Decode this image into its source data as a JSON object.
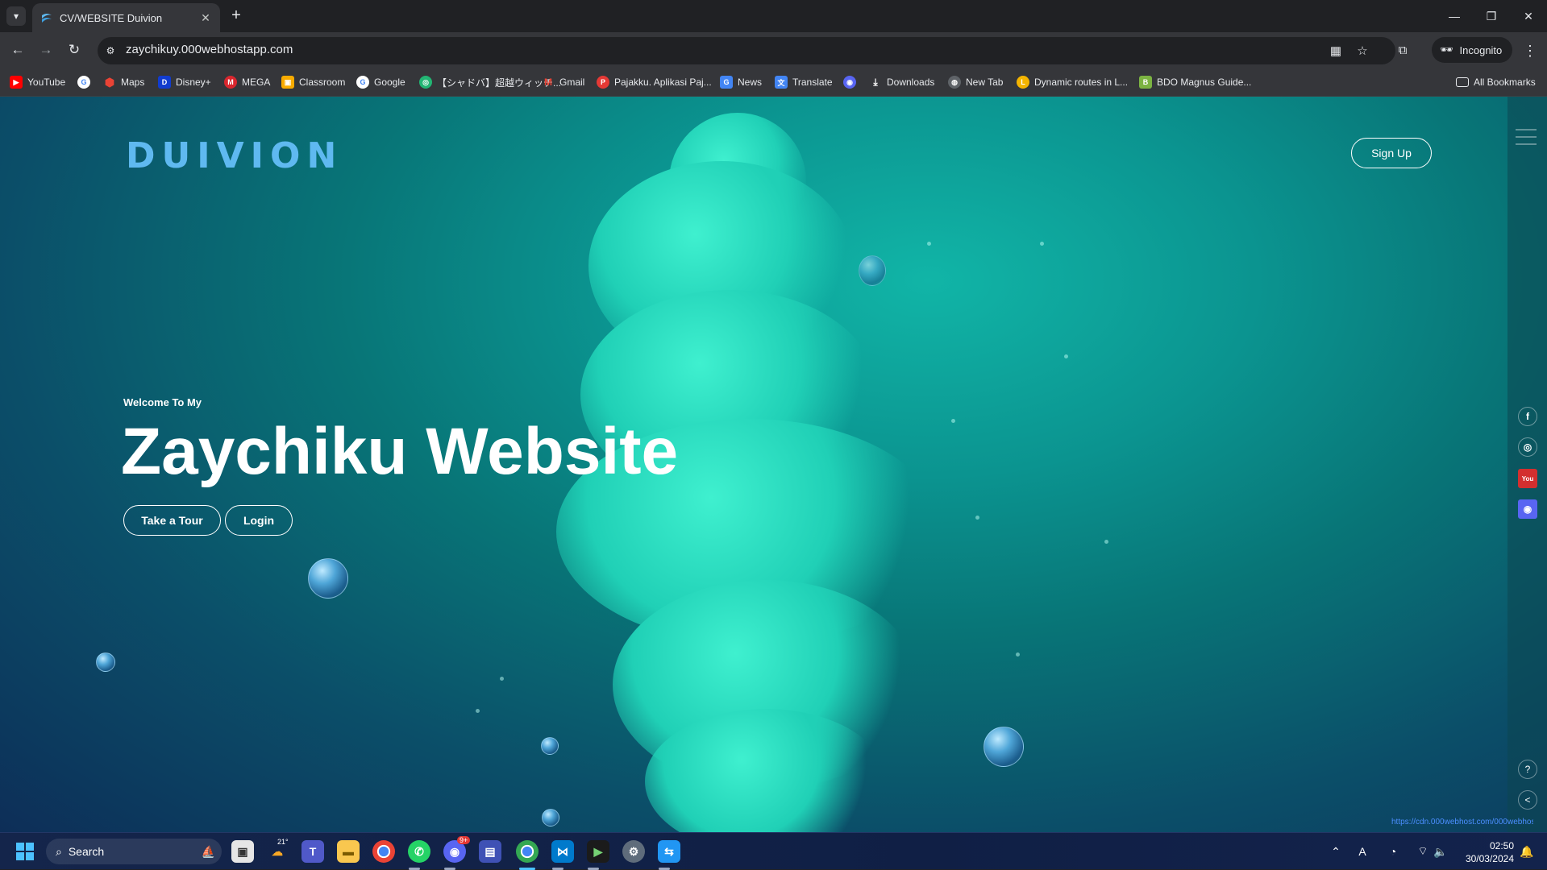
{
  "browser": {
    "tab_title": "CV/WEBSITE Duivion",
    "url": "zaychikuy.000webhostapp.com",
    "incognito_label": "Incognito",
    "all_bookmarks_label": "All Bookmarks",
    "bookmarks": [
      {
        "label": "YouTube",
        "icon": "youtube-icon",
        "color": "#ff0000"
      },
      {
        "label": "",
        "icon": "google-icon",
        "color": "#ffffff"
      },
      {
        "label": "Maps",
        "icon": "maps-icon",
        "color": "#34a853"
      },
      {
        "label": "Disney+",
        "icon": "disney-icon",
        "color": "#113ccf"
      },
      {
        "label": "MEGA",
        "icon": "mega-icon",
        "color": "#d9272e"
      },
      {
        "label": "Classroom",
        "icon": "classroom-icon",
        "color": "#f9ab00"
      },
      {
        "label": "Google",
        "icon": "google-icon",
        "color": "#ffffff"
      },
      {
        "label": "【シャドバ】超越ウィッチ...",
        "icon": "game-icon",
        "color": "#22b573"
      },
      {
        "label": "Gmail",
        "icon": "gmail-icon",
        "color": "#ea4335"
      },
      {
        "label": "Pajakku. Aplikasi Paj...",
        "icon": "pajakku-icon",
        "color": "#e53935"
      },
      {
        "label": "News",
        "icon": "news-icon",
        "color": "#4285f4"
      },
      {
        "label": "Translate",
        "icon": "translate-icon",
        "color": "#4285f4"
      },
      {
        "label": "",
        "icon": "discord-icon",
        "color": "#5865f2"
      },
      {
        "label": "Downloads",
        "icon": "download-icon",
        "color": "#e8eaed"
      },
      {
        "label": "New Tab",
        "icon": "globe-icon",
        "color": "#e8eaed"
      },
      {
        "label": "Dynamic routes in L...",
        "icon": "laravel-icon",
        "color": "#f4b400"
      },
      {
        "label": "BDO Magnus Guide...",
        "icon": "bdo-icon",
        "color": "#7cb342"
      }
    ]
  },
  "page": {
    "logo": "DUIVION",
    "signup_label": "Sign Up",
    "welcome": "Welcome To My",
    "hero_title": "Zaychiku Website",
    "tour_label": "Take a Tour",
    "login_label": "Login",
    "broken_image_alt": "https://cdn.000webhost.com/000webhost/logo/footer-powered-by-000webhost-white2.png",
    "social": [
      {
        "icon": "facebook-icon",
        "glyph": "f"
      },
      {
        "icon": "instagram-icon",
        "glyph": "◎"
      },
      {
        "icon": "youtube-icon",
        "glyph": "You"
      },
      {
        "icon": "discord-icon",
        "glyph": "◉"
      }
    ],
    "help_glyph": "?",
    "share_glyph": "<"
  },
  "taskbar": {
    "search_label": "Search",
    "weather_temp": "21°",
    "discord_badge": "9+",
    "time": "02:50",
    "date": "30/03/2024"
  },
  "colors": {
    "logo": "#5fb9f0",
    "chrome_dark": "#202124",
    "chrome_toolbar": "#35363a",
    "taskbar": "#14254b"
  }
}
